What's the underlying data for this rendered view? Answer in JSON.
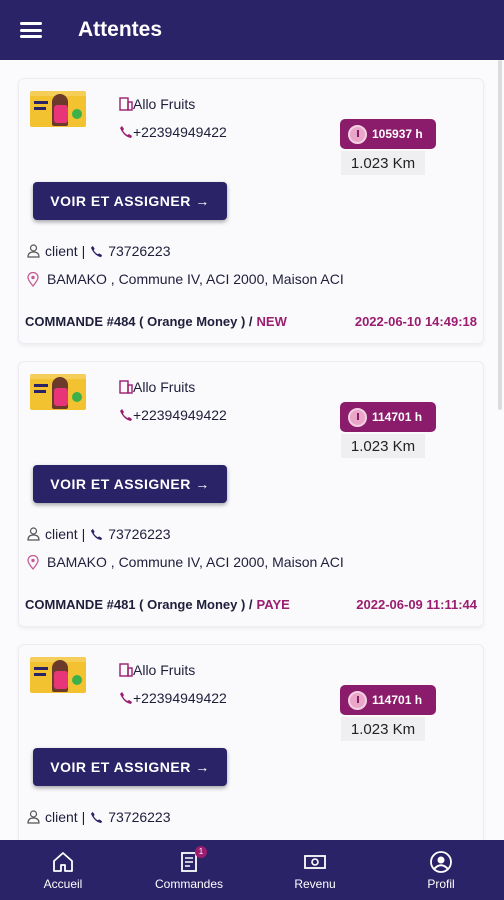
{
  "header": {
    "title": "Attentes",
    "menu_icon": "menu-icon"
  },
  "orders": [
    {
      "shop_name": "Allo Fruits",
      "shop_phone": "+22394949422",
      "time_badge": "105937 h",
      "distance": "1.023 Km",
      "assign_label": "VOIR ET ASSIGNER →",
      "client_label": "client |",
      "client_phone": "73726223",
      "address": "BAMAKO , Commune IV, ACI 2000, Maison ACI",
      "order_text": "COMMANDE #484 ( Orange Money ) /",
      "status": "NEW",
      "date": "2022-06-10 14:49:18"
    },
    {
      "shop_name": "Allo Fruits",
      "shop_phone": "+22394949422",
      "time_badge": "114701 h",
      "distance": "1.023 Km",
      "assign_label": "VOIR ET ASSIGNER →",
      "client_label": "client |",
      "client_phone": "73726223",
      "address": "BAMAKO , Commune IV, ACI 2000, Maison ACI",
      "order_text": "COMMANDE #481 ( Orange Money ) /",
      "status": "PAYE",
      "date": "2022-06-09 11:11:44"
    },
    {
      "shop_name": "Allo Fruits",
      "shop_phone": "+22394949422",
      "time_badge": "114701 h",
      "distance": "1.023 Km",
      "assign_label": "VOIR ET ASSIGNER →",
      "client_label": "client |",
      "client_phone": "73726223",
      "address": "",
      "order_text": "",
      "status": "",
      "date": ""
    }
  ],
  "bottom_nav": [
    {
      "label": "Accueil",
      "icon": "home-icon"
    },
    {
      "label": "Commandes",
      "icon": "orders-icon",
      "badge": "1"
    },
    {
      "label": "Revenu",
      "icon": "money-icon"
    },
    {
      "label": "Profil",
      "icon": "profile-icon"
    }
  ],
  "colors": {
    "primary": "#2b2367",
    "accent": "#9b1d6f",
    "badge": "#8b1b6b"
  }
}
